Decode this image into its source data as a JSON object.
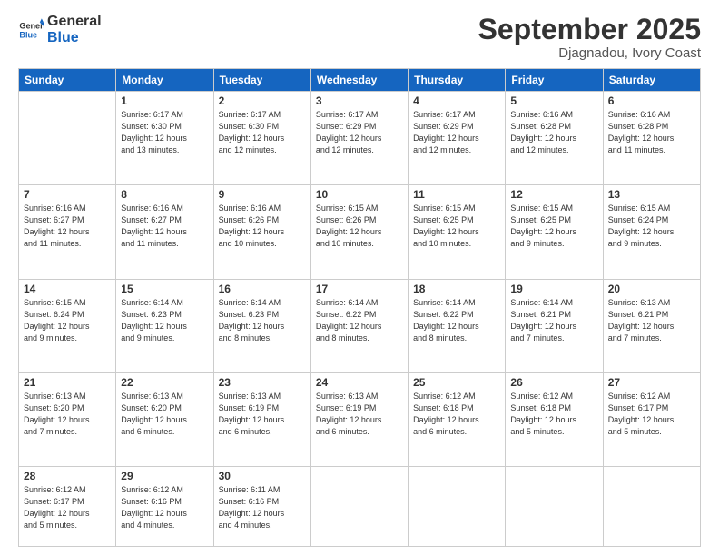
{
  "logo": {
    "line1": "General",
    "line2": "Blue"
  },
  "title": "September 2025",
  "subtitle": "Djagnadou, Ivory Coast",
  "header_days": [
    "Sunday",
    "Monday",
    "Tuesday",
    "Wednesday",
    "Thursday",
    "Friday",
    "Saturday"
  ],
  "weeks": [
    [
      {
        "day": "",
        "info": ""
      },
      {
        "day": "1",
        "info": "Sunrise: 6:17 AM\nSunset: 6:30 PM\nDaylight: 12 hours\nand 13 minutes."
      },
      {
        "day": "2",
        "info": "Sunrise: 6:17 AM\nSunset: 6:30 PM\nDaylight: 12 hours\nand 12 minutes."
      },
      {
        "day": "3",
        "info": "Sunrise: 6:17 AM\nSunset: 6:29 PM\nDaylight: 12 hours\nand 12 minutes."
      },
      {
        "day": "4",
        "info": "Sunrise: 6:17 AM\nSunset: 6:29 PM\nDaylight: 12 hours\nand 12 minutes."
      },
      {
        "day": "5",
        "info": "Sunrise: 6:16 AM\nSunset: 6:28 PM\nDaylight: 12 hours\nand 12 minutes."
      },
      {
        "day": "6",
        "info": "Sunrise: 6:16 AM\nSunset: 6:28 PM\nDaylight: 12 hours\nand 11 minutes."
      }
    ],
    [
      {
        "day": "7",
        "info": "Sunrise: 6:16 AM\nSunset: 6:27 PM\nDaylight: 12 hours\nand 11 minutes."
      },
      {
        "day": "8",
        "info": "Sunrise: 6:16 AM\nSunset: 6:27 PM\nDaylight: 12 hours\nand 11 minutes."
      },
      {
        "day": "9",
        "info": "Sunrise: 6:16 AM\nSunset: 6:26 PM\nDaylight: 12 hours\nand 10 minutes."
      },
      {
        "day": "10",
        "info": "Sunrise: 6:15 AM\nSunset: 6:26 PM\nDaylight: 12 hours\nand 10 minutes."
      },
      {
        "day": "11",
        "info": "Sunrise: 6:15 AM\nSunset: 6:25 PM\nDaylight: 12 hours\nand 10 minutes."
      },
      {
        "day": "12",
        "info": "Sunrise: 6:15 AM\nSunset: 6:25 PM\nDaylight: 12 hours\nand 9 minutes."
      },
      {
        "day": "13",
        "info": "Sunrise: 6:15 AM\nSunset: 6:24 PM\nDaylight: 12 hours\nand 9 minutes."
      }
    ],
    [
      {
        "day": "14",
        "info": "Sunrise: 6:15 AM\nSunset: 6:24 PM\nDaylight: 12 hours\nand 9 minutes."
      },
      {
        "day": "15",
        "info": "Sunrise: 6:14 AM\nSunset: 6:23 PM\nDaylight: 12 hours\nand 9 minutes."
      },
      {
        "day": "16",
        "info": "Sunrise: 6:14 AM\nSunset: 6:23 PM\nDaylight: 12 hours\nand 8 minutes."
      },
      {
        "day": "17",
        "info": "Sunrise: 6:14 AM\nSunset: 6:22 PM\nDaylight: 12 hours\nand 8 minutes."
      },
      {
        "day": "18",
        "info": "Sunrise: 6:14 AM\nSunset: 6:22 PM\nDaylight: 12 hours\nand 8 minutes."
      },
      {
        "day": "19",
        "info": "Sunrise: 6:14 AM\nSunset: 6:21 PM\nDaylight: 12 hours\nand 7 minutes."
      },
      {
        "day": "20",
        "info": "Sunrise: 6:13 AM\nSunset: 6:21 PM\nDaylight: 12 hours\nand 7 minutes."
      }
    ],
    [
      {
        "day": "21",
        "info": "Sunrise: 6:13 AM\nSunset: 6:20 PM\nDaylight: 12 hours\nand 7 minutes."
      },
      {
        "day": "22",
        "info": "Sunrise: 6:13 AM\nSunset: 6:20 PM\nDaylight: 12 hours\nand 6 minutes."
      },
      {
        "day": "23",
        "info": "Sunrise: 6:13 AM\nSunset: 6:19 PM\nDaylight: 12 hours\nand 6 minutes."
      },
      {
        "day": "24",
        "info": "Sunrise: 6:13 AM\nSunset: 6:19 PM\nDaylight: 12 hours\nand 6 minutes."
      },
      {
        "day": "25",
        "info": "Sunrise: 6:12 AM\nSunset: 6:18 PM\nDaylight: 12 hours\nand 6 minutes."
      },
      {
        "day": "26",
        "info": "Sunrise: 6:12 AM\nSunset: 6:18 PM\nDaylight: 12 hours\nand 5 minutes."
      },
      {
        "day": "27",
        "info": "Sunrise: 6:12 AM\nSunset: 6:17 PM\nDaylight: 12 hours\nand 5 minutes."
      }
    ],
    [
      {
        "day": "28",
        "info": "Sunrise: 6:12 AM\nSunset: 6:17 PM\nDaylight: 12 hours\nand 5 minutes."
      },
      {
        "day": "29",
        "info": "Sunrise: 6:12 AM\nSunset: 6:16 PM\nDaylight: 12 hours\nand 4 minutes."
      },
      {
        "day": "30",
        "info": "Sunrise: 6:11 AM\nSunset: 6:16 PM\nDaylight: 12 hours\nand 4 minutes."
      },
      {
        "day": "",
        "info": ""
      },
      {
        "day": "",
        "info": ""
      },
      {
        "day": "",
        "info": ""
      },
      {
        "day": "",
        "info": ""
      }
    ]
  ]
}
